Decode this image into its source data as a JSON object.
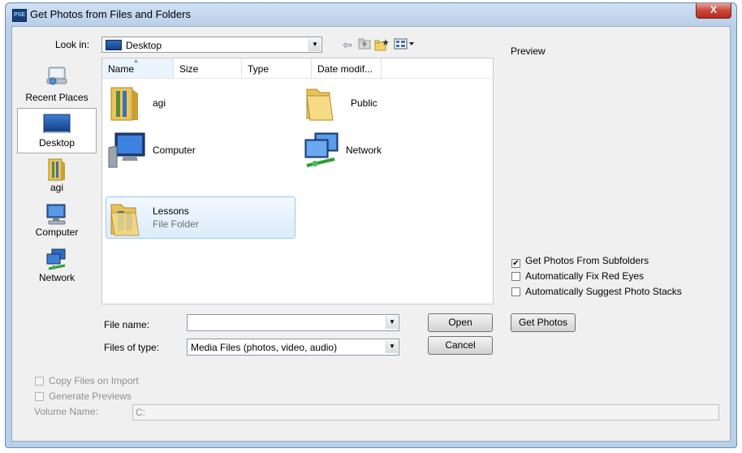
{
  "window": {
    "title": "Get Photos from Files and Folders",
    "app_icon_text": "PSE",
    "close_glyph": "X"
  },
  "lookin": {
    "label": "Look in:",
    "value": "Desktop"
  },
  "preview_label": "Preview",
  "places": [
    {
      "label": "Recent Places",
      "icon": "recent-places-icon",
      "selected": false
    },
    {
      "label": "Desktop",
      "icon": "desktop-icon",
      "selected": true
    },
    {
      "label": "agi",
      "icon": "user-folder-icon",
      "selected": false
    },
    {
      "label": "Computer",
      "icon": "computer-icon",
      "selected": false
    },
    {
      "label": "Network",
      "icon": "network-icon",
      "selected": false
    }
  ],
  "columns": [
    {
      "label": "Name",
      "sorted": true
    },
    {
      "label": "Size"
    },
    {
      "label": "Type"
    },
    {
      "label": "Date modif..."
    }
  ],
  "files": [
    {
      "name": "agi",
      "type": "",
      "icon": "user-folder-icon"
    },
    {
      "name": "Public",
      "type": "",
      "icon": "folder-icon"
    },
    {
      "name": "Computer",
      "type": "",
      "icon": "computer-icon"
    },
    {
      "name": "Network",
      "type": "",
      "icon": "network-icon"
    },
    {
      "name": "Lessons",
      "type": "File Folder",
      "icon": "folder-icon",
      "selected": true
    }
  ],
  "filename": {
    "label": "File name:",
    "value": ""
  },
  "filetype": {
    "label": "Files of type:",
    "value": "Media Files (photos, video, audio)"
  },
  "buttons": {
    "open": "Open",
    "cancel": "Cancel",
    "get_photos": "Get Photos"
  },
  "options": [
    {
      "label": "Get Photos From Subfolders",
      "checked": true
    },
    {
      "label": "Automatically Fix Red Eyes",
      "checked": false
    },
    {
      "label": "Automatically Suggest Photo Stacks",
      "checked": false
    }
  ],
  "import": {
    "copy_files": "Copy Files on Import",
    "generate_previews": "Generate Previews",
    "volume_label": "Volume Name:",
    "volume_value": "C:"
  },
  "colors": {
    "selection": "#dbecfb",
    "selection_border": "#9ccaf0",
    "folder": "#f2d36b"
  }
}
